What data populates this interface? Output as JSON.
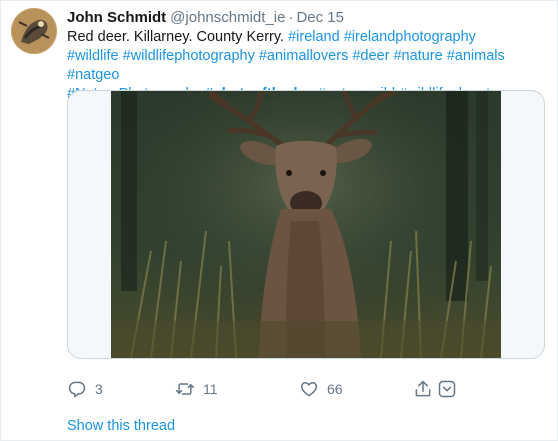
{
  "tweet": {
    "author_name": "John Schmidt",
    "author_handle": "@johnschmidt_ie",
    "separator": "·",
    "date": "Dec 15",
    "text_plain": "Red deer. Killarney. County Kerry.",
    "hashtags": [
      "#ireland",
      "#irelandphotography",
      "#wildlife",
      "#wildlifephotography",
      "#animallovers",
      "#deer",
      "#nature",
      "#animals",
      "#natgeo",
      "#NaturePhotography",
      "#photooftheday",
      "#natgeowild",
      "#wildlifeplanet"
    ],
    "replies": "3",
    "retweets": "11",
    "likes": "66",
    "show_thread": "Show this thread"
  },
  "icons": {
    "reply": "reply-icon",
    "retweet": "retweet-icon",
    "like": "heart-icon",
    "share": "share-icon",
    "more": "chevron-down-icon"
  },
  "colors": {
    "link": "#1b95e0",
    "secondary_text": "#657786",
    "border": "#ccd6dd"
  }
}
